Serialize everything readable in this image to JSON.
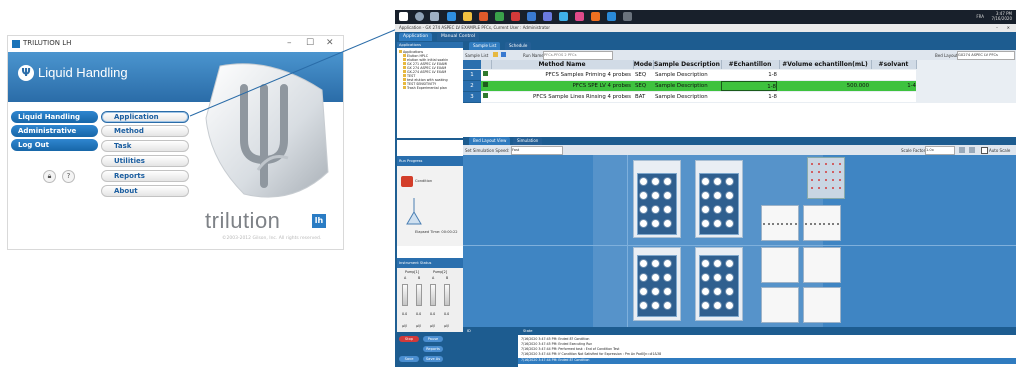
{
  "launcher": {
    "window_title": "TRILUTION LH",
    "app_name": "Liquid Handling",
    "nav": [
      "Liquid Handling",
      "Administrative Tools",
      "Log Out"
    ],
    "sub": [
      "Application",
      "Method",
      "Task",
      "Utilities",
      "Reports",
      "About"
    ],
    "active_sub": "Application",
    "brand": "trilution",
    "brand_badge": "lh",
    "copyright": "©2003-2012 Gilson, Inc. All rights reserved.",
    "icons": [
      "lock-icon",
      "help-icon"
    ],
    "help_glyph": "?"
  },
  "app": {
    "title": "Application - GX 274 ASPEC LV EXAMPLE PFCs, Current User : Administrator",
    "tabs": [
      "Application",
      "Manual Control"
    ],
    "taskbar_clock": [
      "3:47 PM",
      "7/16/2020"
    ],
    "taskbar_lang": "FRA",
    "tree": {
      "header": "Applications",
      "root": "Applications",
      "items": [
        "Elution HPLC",
        "elution with initial soakin",
        "GX 271 ASPEC LV EXAMI",
        "GX 274 ASPEC LV EXAM",
        "GX-274 ASPEC LV EXAM",
        "TEST",
        "test elution with soaking",
        "TEST SENSITIVITY",
        "Trash Experimental plan"
      ]
    },
    "sample_tabs": [
      "Sample List",
      "Schedule"
    ],
    "sample_toolbar": {
      "label": "Sample List",
      "run_name_label": "Run Name",
      "run_name": "PFCs-PFOS 2 PFCs",
      "bed_layout_label": "Bed Layout",
      "bed_layout": "GX274 ASPEC LV PFCs"
    },
    "grid": {
      "columns": [
        "Method Name",
        "Mode",
        "Sample Description",
        "#Echantillon",
        "#Volume echantillon(mL)",
        "#solvant"
      ],
      "rows": [
        {
          "num": "1",
          "method": "PFCS Samples Priming 4 probes",
          "mode": "SEQ",
          "desc": "Sample Description",
          "ech": "1-8",
          "vol": "",
          "solv": ""
        },
        {
          "num": "2",
          "method": "PFCS SPE LV 4 probes",
          "mode": "SEQ",
          "desc": "Sample Description",
          "ech": "1-8",
          "vol": "500.000",
          "solv": "1-4"
        },
        {
          "num": "3",
          "method": "PFCS Sample Lines Rinsing 4 probes",
          "mode": "BAT",
          "desc": "Sample Description",
          "ech": "1-8",
          "vol": "",
          "solv": ""
        }
      ]
    },
    "layout_tabs": [
      "Bed Layout View",
      "Simulation"
    ],
    "layout_toolbar": {
      "speed_label": "Set Simulation Speed:",
      "speed": "Fast",
      "scale_label": "Scale Factor:",
      "scale": "1.0x",
      "auto_scale": "Auto Scale"
    },
    "run_progress": {
      "header": "Run Progress",
      "step": "Condition",
      "elapsed_label": "Elapsed Time:",
      "elapsed": "00:00:22"
    },
    "instrument": {
      "header": "Instrument Status",
      "pumps": [
        "Pump[1]",
        "Pump[2]"
      ],
      "letters": [
        "A",
        "B",
        "A",
        "B"
      ],
      "values": [
        "0.0",
        "0.0",
        "0.0",
        "0.0"
      ],
      "units": [
        "µl/l",
        "µl/l",
        "µl/l",
        "µl/l"
      ]
    },
    "controls": [
      "Stop",
      "Pause",
      "Reports",
      "Save",
      "Save As"
    ],
    "log_headers": [
      "ID",
      "State"
    ],
    "log_lines": [
      "7/16/2020 3:47:45 PM: Ended 8? Condition",
      "7/16/2020 3:47:45 PM: Ended Executing Run",
      "7/16/2020 3:47:44 PM: Performed task : End of Condition Test",
      "7/16/2020 3:47:44 PM: If Condition Not Satisfied for Expression : Pm An Pad0[n=#1&38",
      "7/16/2020 3:47:44 PM: Ended 8? Condition"
    ]
  },
  "colors": {
    "accent": "#2a6ca8",
    "selected_row": "#3ec23e",
    "layout_bg": "#3f85c3"
  }
}
